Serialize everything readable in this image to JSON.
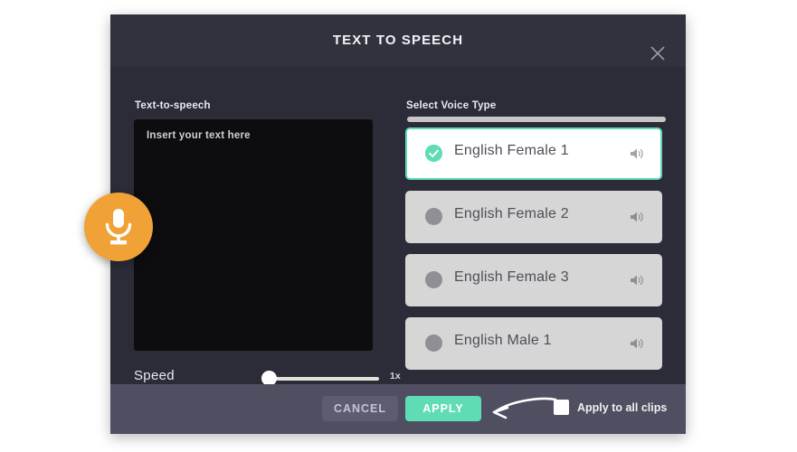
{
  "dialog": {
    "title": "TEXT TO SPEECH",
    "close_icon": "close-icon"
  },
  "left_panel": {
    "label": "Text-to-speech",
    "textarea_placeholder": "Insert your text here",
    "textarea_value": ""
  },
  "speed": {
    "label": "Speed",
    "value": "1x",
    "slider_position_percent": 5
  },
  "right_panel": {
    "label": "Select Voice Type",
    "voices": [
      {
        "name": "English Female 1",
        "selected": true,
        "speaker_icon": "speaker-icon"
      },
      {
        "name": "English Female 2",
        "selected": false,
        "speaker_icon": "speaker-icon"
      },
      {
        "name": "English Female 3",
        "selected": false,
        "speaker_icon": "speaker-icon"
      },
      {
        "name": "English Male 1",
        "selected": false,
        "speaker_icon": "speaker-icon"
      }
    ]
  },
  "footer": {
    "cancel_label": "CANCEL",
    "apply_label": "APPLY",
    "apply_to_all_label": "Apply to all clips",
    "apply_to_all_checked": false
  },
  "badge": {
    "icon": "microphone-icon"
  },
  "colors": {
    "accent_teal": "#5fdcb5",
    "badge_orange": "#f0a236",
    "dialog_bg": "#2c2c38",
    "header_bg": "#32323e",
    "footer_bg": "#4f4f61",
    "textarea_bg": "#0d0d0f",
    "card_bg": "#d6d6d7"
  }
}
